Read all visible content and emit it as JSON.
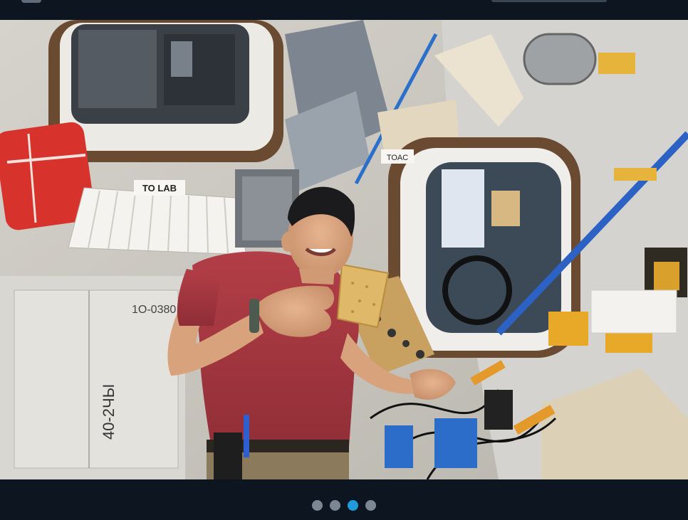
{
  "header": {
    "logo_icon": "agency-logo-icon",
    "search_icon": "search-pill"
  },
  "slideshow": {
    "slide": {
      "image_icon": "astronaut-photo",
      "sign_to_lab": "TO LAB",
      "label_toac": "TOAC",
      "label_hatch_left": "40-2ЧЫ",
      "label_stowage": "1O-0380"
    },
    "dots": [
      {
        "label": "1",
        "active": false
      },
      {
        "label": "2",
        "active": false
      },
      {
        "label": "3",
        "active": true
      },
      {
        "label": "4",
        "active": false
      }
    ],
    "colors": {
      "dot_inactive": "#7c8794",
      "dot_active": "#1f9bdb",
      "bar_background": "#0c1520"
    }
  }
}
